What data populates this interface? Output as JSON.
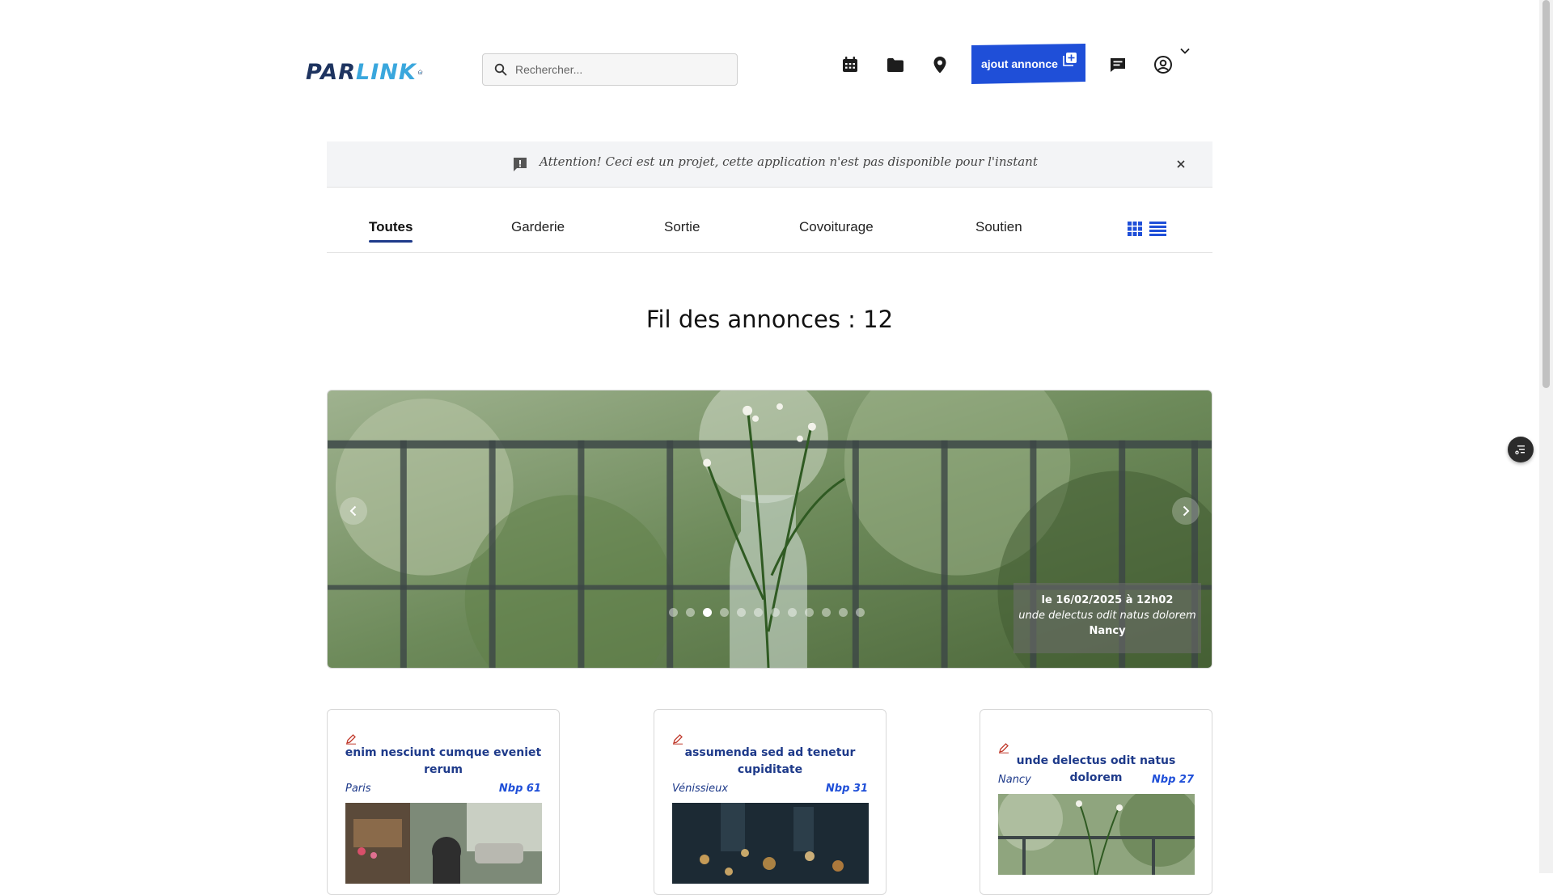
{
  "header": {
    "logo_part1": "PAR",
    "logo_part2": "LINK",
    "search_placeholder": "Rechercher...",
    "add_button_label": "ajout annonce",
    "icons": [
      "calendar-icon",
      "folder-icon",
      "map-pin-icon",
      "message-icon",
      "user-icon",
      "chevron-down-icon"
    ]
  },
  "alert": {
    "text": "Attention! Ceci est un projet, cette application n'est pas disponible pour l'instant"
  },
  "tabs": [
    {
      "label": "Toutes",
      "active": true
    },
    {
      "label": "Garderie",
      "active": false
    },
    {
      "label": "Sortie",
      "active": false
    },
    {
      "label": "Covoiturage",
      "active": false
    },
    {
      "label": "Soutien",
      "active": false
    }
  ],
  "view_toggle": [
    "grid-view-icon",
    "list-view-icon"
  ],
  "feed_title": "Fil des annonces : 12",
  "carousel": {
    "slide_count": 12,
    "active_index": 2,
    "caption": {
      "date": "le 16/02/2025 à 12h02",
      "title": "unde delectus odit natus dolorem",
      "city": "Nancy"
    }
  },
  "cards": [
    {
      "title": "enim nesciunt cumque eveniet rerum",
      "city": "Paris",
      "nbp": "Nbp 61"
    },
    {
      "title": "assumenda sed ad tenetur cupiditate",
      "city": "Vénissieux",
      "nbp": "Nbp 31"
    },
    {
      "title": "unde delectus odit natus dolorem",
      "city": "Nancy",
      "nbp": "Nbp 27"
    }
  ],
  "colors": {
    "primary": "#1f4fd8",
    "navy": "#1e3a8a",
    "alert_bg": "#f3f4f6",
    "edit_icon": "#c0392b"
  }
}
